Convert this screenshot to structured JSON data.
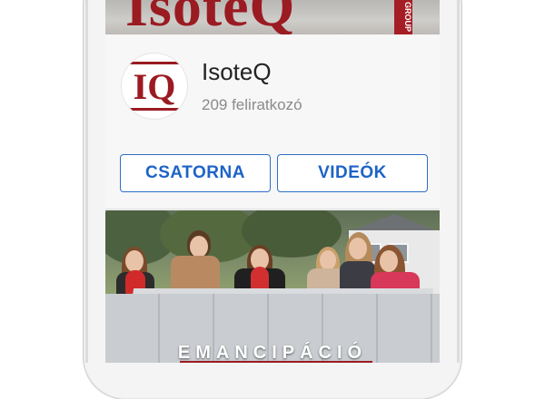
{
  "banner": {
    "text": "IsoteQ",
    "side_text": "GROUP"
  },
  "channel": {
    "logo_text": "IQ",
    "name": "IsoteQ",
    "subscribers": "209 feliratkozó"
  },
  "buttons": {
    "channel_label": "CSATORNA",
    "videos_label": "VIDEÓK"
  },
  "video": {
    "caption": "EMANCIPÁCIÓ"
  },
  "colors": {
    "brand_red": "#9b1b22",
    "link_blue": "#1d63c7"
  }
}
